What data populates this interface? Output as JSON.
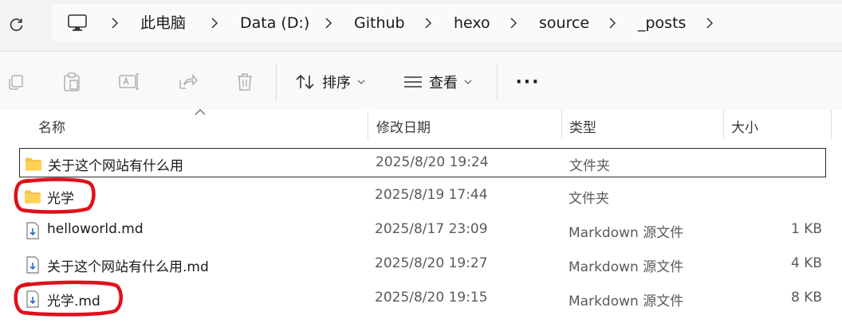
{
  "toolbar": {
    "refresh_icon": "refresh-icon",
    "breadcrumb": [
      "此电脑",
      "Data (D:)",
      "Github",
      "hexo",
      "source",
      "_posts"
    ]
  },
  "commandbar": {
    "sort_label": "排序",
    "view_label": "查看",
    "more_label": "···"
  },
  "columns": {
    "name": "名称",
    "modified": "修改日期",
    "type": "类型",
    "size": "大小"
  },
  "files": [
    {
      "name": "关于这个网站有什么用",
      "modified": "2025/8/20 19:24",
      "type": "文件夹",
      "size": "",
      "kind": "folder",
      "selected": true
    },
    {
      "name": "光学",
      "modified": "2025/8/19 17:44",
      "type": "文件夹",
      "size": "",
      "kind": "folder",
      "selected": false
    },
    {
      "name": "helloworld.md",
      "modified": "2025/8/17 23:09",
      "type": "Markdown 源文件",
      "size": "1 KB",
      "kind": "md",
      "selected": false
    },
    {
      "name": "关于这个网站有什么用.md",
      "modified": "2025/8/20 19:27",
      "type": "Markdown 源文件",
      "size": "4 KB",
      "kind": "md",
      "selected": false
    },
    {
      "name": "光学.md",
      "modified": "2025/8/20 19:15",
      "type": "Markdown 源文件",
      "size": "8 KB",
      "kind": "md",
      "selected": false
    }
  ],
  "colors": {
    "accent_annotation": "#e0101a",
    "folder": "#f4c246",
    "md_icon_blue": "#2f6fc0"
  }
}
